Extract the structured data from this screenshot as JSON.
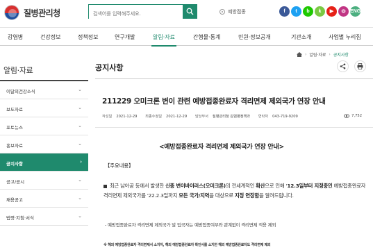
{
  "header": {
    "logo_text": "질병관리청",
    "search_placeholder": "검색어를 입력해주세요.",
    "vaccination_link": "예방접종",
    "social": [
      {
        "name": "facebook",
        "label": "f",
        "color": "#3b5998"
      },
      {
        "name": "twitter",
        "label": "t",
        "color": "#1da1f2"
      },
      {
        "name": "blog",
        "label": "b",
        "color": "#1ec800"
      },
      {
        "name": "kakao",
        "label": "k",
        "color": "#7ac943"
      },
      {
        "name": "youtube",
        "label": "▶",
        "color": "#e62117"
      },
      {
        "name": "instagram",
        "label": "◎",
        "color": "#c13584"
      },
      {
        "name": "english",
        "label": "ENG",
        "color": "#4caf80"
      }
    ]
  },
  "nav": {
    "items": [
      "감염병",
      "건강정보",
      "정책정보",
      "연구개발",
      "알림·자료",
      "간행물·통계",
      "민원·정보공개",
      "기관소개",
      "사업별 누리집"
    ],
    "active_index": 4
  },
  "sidebar": {
    "title": "알림·자료",
    "items": [
      "이달의건강소식",
      "보도자료",
      "포토뉴스",
      "홍보자료",
      "공지사항",
      "공고/공시",
      "채용공고",
      "법령·지침·서식"
    ],
    "active_index": 4
  },
  "breadcrumb": {
    "items": [
      "알림·자료",
      "공지사항"
    ]
  },
  "page": {
    "title": "공지사항",
    "post_title": "211229 오미크론 변이 관련 예방접종완료자 격리면제 제외국가 연장 안내",
    "meta": {
      "created_label": "작성일",
      "created": "2021-12-29",
      "modified_label": "최종수정일",
      "modified": "2021-12-29",
      "dept_label": "담당부서",
      "dept": "질병관리청 감염병정책과",
      "phone_label": "연락처",
      "phone": "043-719-9209",
      "views": "7,752"
    },
    "body_heading": "<예방접종완료자 격리면제 제외국가 연장 안내>",
    "sub_heading": "【주요내용】",
    "para_1": "최근 남아공 등에서 발생한",
    "para_2": "신종 변이바이러스(오미크론)",
    "para_3": "의 전세계적인",
    "para_4": "확산",
    "para_5": "으로 인해 '",
    "para_6": "12.3일부터 지정중인",
    "para_7": " 예방접종완료자 격리면제 제외국가를 '22.2.3일까지",
    "para_8": "모든 국가/지역",
    "para_9": "을 대상으로",
    "para_10": "지정 연장함",
    "para_11": "을 알려드립니다.",
    "note": "- 예방접종완료자 격리면제 제외국가 발 입국자는 예방접종여부와 관계없이 격리면제 적용 제외",
    "footnote": "※ 해외 예방접종완료자 격리면제서 소지자, 해외 예방접종완료자 확인서를 소지한 해외 예방접종완료자도 격리면제 제외"
  }
}
